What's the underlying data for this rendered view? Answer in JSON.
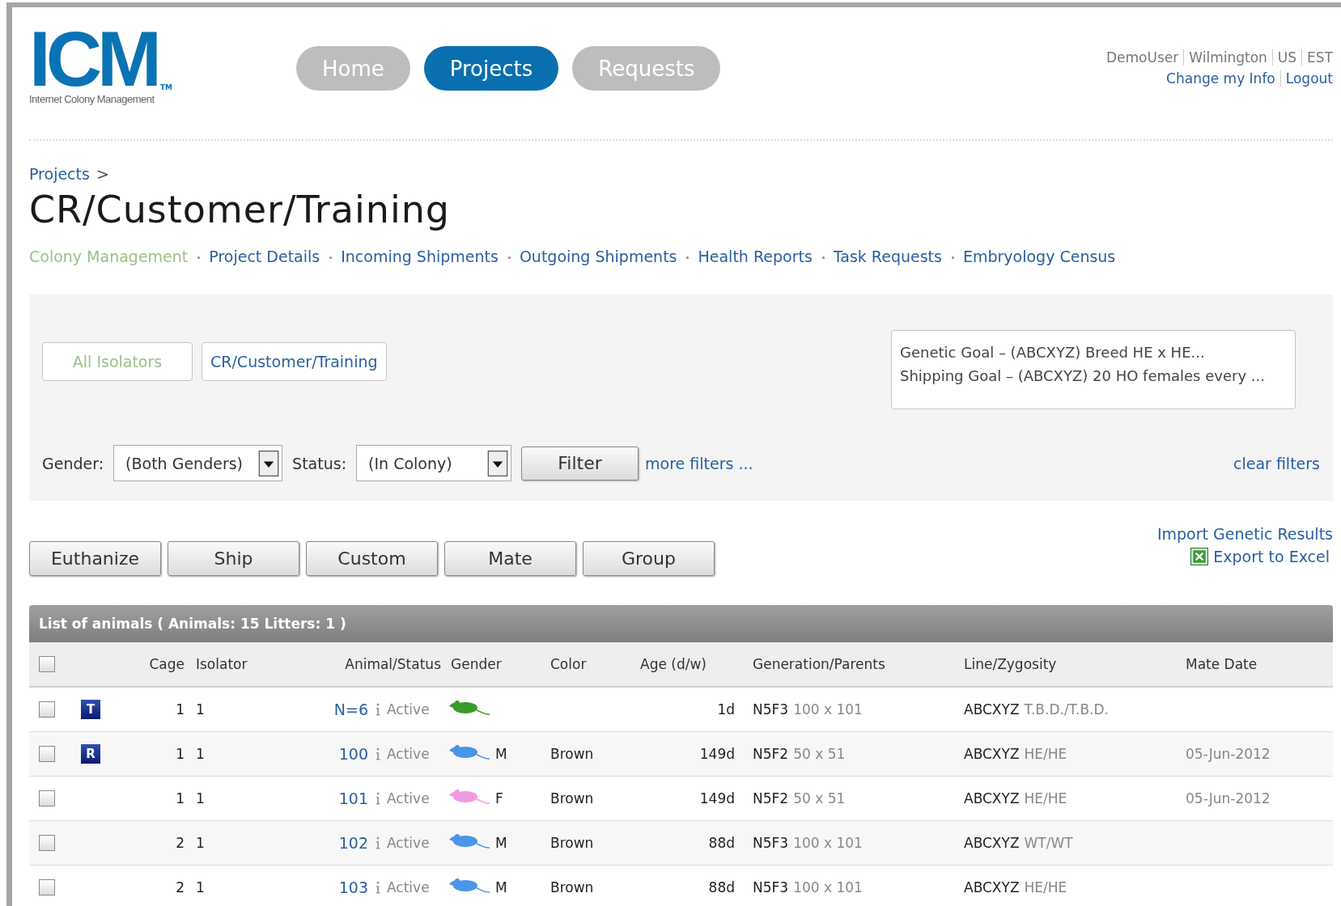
{
  "logo": {
    "mark": "ICM",
    "trademark": "TM",
    "tagline": "Internet Colony Management"
  },
  "nav": [
    {
      "label": "Home",
      "selected": false
    },
    {
      "label": "Projects",
      "selected": true
    },
    {
      "label": "Requests",
      "selected": false
    }
  ],
  "user_info": {
    "items": [
      "DemoUser",
      "Wilmington",
      "US",
      "EST"
    ],
    "links": [
      "Change my Info",
      "Logout"
    ]
  },
  "breadcrumb": [
    "Projects",
    ">"
  ],
  "title": "CR/Customer/Training",
  "subnav": [
    {
      "label": "Colony Management",
      "selected": true
    },
    {
      "label": "Project Details",
      "selected": false
    },
    {
      "label": "Incoming Shipments",
      "selected": false
    },
    {
      "label": "Outgoing Shipments",
      "selected": false
    },
    {
      "label": "Health Reports",
      "selected": false
    },
    {
      "label": "Task Requests",
      "selected": false
    },
    {
      "label": "Embryology Census",
      "selected": false
    }
  ],
  "isolators": [
    {
      "label": "All Isolators",
      "selected": true
    },
    {
      "label": "CR/Customer/Training",
      "selected": false
    }
  ],
  "goals": [
    "Genetic Goal – (ABCXYZ) Breed HE x HE...",
    "Shipping Goal – (ABCXYZ) 20 HO females every ..."
  ],
  "filters": {
    "gender_label": "Gender:",
    "gender_value": "(Both Genders)",
    "status_label": "Status:",
    "status_value": "(In Colony)",
    "filter_button": "Filter",
    "more_filters": "more filters ...",
    "clear_filters": "clear filters"
  },
  "actions": [
    "Euthanize",
    "Ship",
    "Custom",
    "Mate",
    "Group"
  ],
  "import_link": "Import Genetic Results",
  "export_link": "Export to Excel",
  "table": {
    "title": "List of animals ( Animals: 15 Litters: 1 )",
    "select_all_checked": false,
    "columns": [
      "Cage",
      "Isolator",
      "Animal/Status",
      "Gender",
      "Color",
      "Age (d/w)",
      "Generation/Parents",
      "Line/Zygosity",
      "Mate Date"
    ],
    "rows": [
      {
        "checked": false,
        "tag": "T",
        "cage": "1",
        "isolator": "1",
        "animal": "N=6",
        "status": "Active",
        "color": "#3a9a2a",
        "gender": "",
        "coat": "",
        "age": "1d",
        "generation": "N5F3",
        "parents": "100 x 101",
        "line": "ABCXYZ",
        "zygosity": "T.B.D./T.B.D.",
        "mate_date": ""
      },
      {
        "checked": false,
        "tag": "R",
        "cage": "1",
        "isolator": "1",
        "animal": "100",
        "status": "Active",
        "color": "#4a95e8",
        "gender": "M",
        "coat": "Brown",
        "age": "149d",
        "generation": "N5F2",
        "parents": "50 x 51",
        "line": "ABCXYZ",
        "zygosity": "HE/HE",
        "mate_date": "05-Jun-2012"
      },
      {
        "checked": false,
        "tag": "",
        "cage": "1",
        "isolator": "1",
        "animal": "101",
        "status": "Active",
        "color": "#f09ae0",
        "gender": "F",
        "coat": "Brown",
        "age": "149d",
        "generation": "N5F2",
        "parents": "50 x 51",
        "line": "ABCXYZ",
        "zygosity": "HE/HE",
        "mate_date": "05-Jun-2012"
      },
      {
        "checked": false,
        "tag": "",
        "cage": "2",
        "isolator": "1",
        "animal": "102",
        "status": "Active",
        "color": "#4a95e8",
        "gender": "M",
        "coat": "Brown",
        "age": "88d",
        "generation": "N5F3",
        "parents": "100 x 101",
        "line": "ABCXYZ",
        "zygosity": "WT/WT",
        "mate_date": ""
      },
      {
        "checked": false,
        "tag": "",
        "cage": "2",
        "isolator": "1",
        "animal": "103",
        "status": "Active",
        "color": "#4a95e8",
        "gender": "M",
        "coat": "Brown",
        "age": "88d",
        "generation": "N5F3",
        "parents": "100 x 101",
        "line": "ABCXYZ",
        "zygosity": "HE/HE",
        "mate_date": ""
      }
    ]
  }
}
